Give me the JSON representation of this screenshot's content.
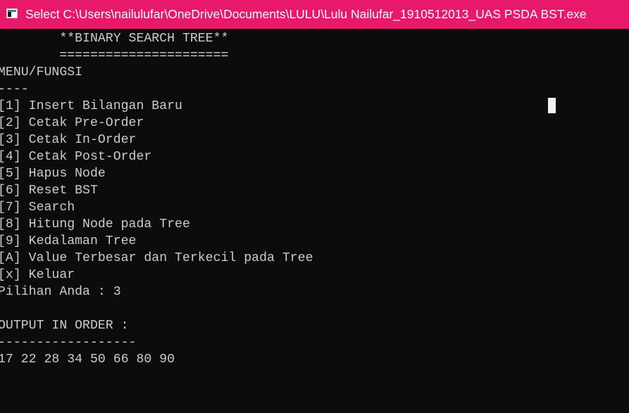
{
  "window": {
    "title": "Select C:\\Users\\nailulufar\\OneDrive\\Documents\\LULU\\Lulu Nailufar_1910512013_UAS PSDA BST.exe",
    "titlebar_color": "#e8196a",
    "background_color": "#0c0c0c",
    "text_color": "#cccccc",
    "icon": "console-app-icon"
  },
  "console": {
    "lines": [
      "        **BINARY SEARCH TREE**",
      "        ======================",
      "MENU/FUNGSI",
      "----",
      "[1] Insert Bilangan Baru",
      "[2] Cetak Pre-Order",
      "[3] Cetak In-Order",
      "[4] Cetak Post-Order",
      "[5] Hapus Node",
      "[6] Reset BST",
      "[7] Search",
      "[8] Hitung Node pada Tree",
      "[9] Kedalaman Tree",
      "[A] Value Terbesar dan Terkecil pada Tree",
      "[x] Keluar",
      "Pilihan Anda : 3",
      "",
      "OUTPUT IN ORDER :",
      "------------------",
      "17 22 28 34 50 66 80 90"
    ]
  }
}
